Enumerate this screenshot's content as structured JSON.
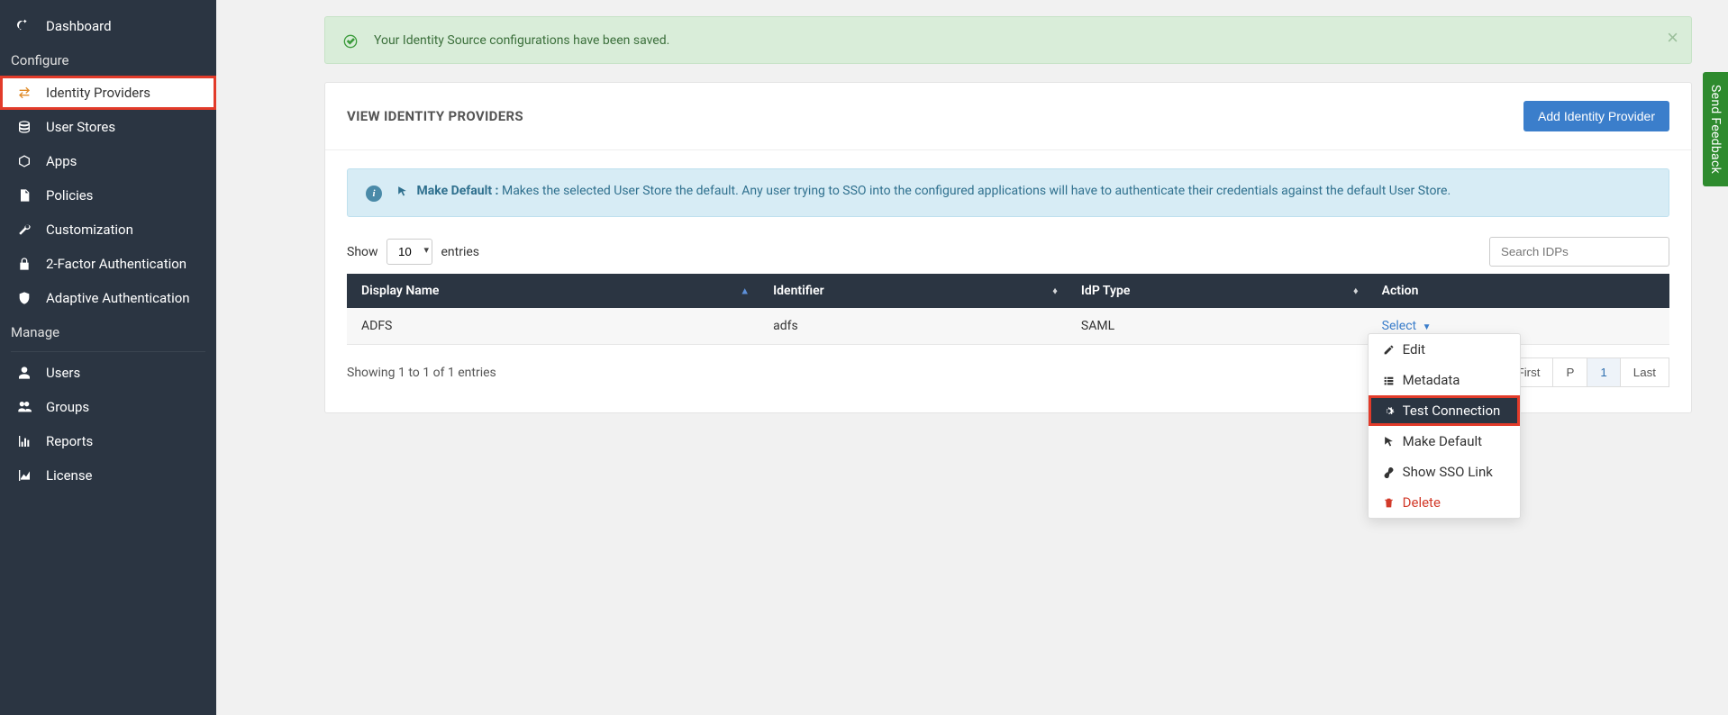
{
  "sidebar": {
    "dashboard": "Dashboard",
    "configure_heading": "Configure",
    "identity_providers": "Identity Providers",
    "user_stores": "User Stores",
    "apps": "Apps",
    "policies": "Policies",
    "customization": "Customization",
    "two_factor": "2-Factor Authentication",
    "adaptive_auth": "Adaptive Authentication",
    "manage_heading": "Manage",
    "users": "Users",
    "groups": "Groups",
    "reports": "Reports",
    "license": "License"
  },
  "alert": {
    "message": "Your Identity Source configurations have been saved."
  },
  "panel": {
    "title": "VIEW IDENTITY PROVIDERS",
    "add_button": "Add Identity Provider"
  },
  "info": {
    "title": "Make Default :",
    "body": " Makes the selected User Store the default. Any user trying to SSO into the configured applications will have to authenticate their credentials against the default User Store."
  },
  "table": {
    "show_label_pre": "Show",
    "show_label_post": "entries",
    "page_size": "10",
    "search_placeholder": "Search IDPs",
    "columns": {
      "display_name": "Display Name",
      "identifier": "Identifier",
      "idp_type": "IdP Type",
      "action": "Action"
    },
    "row": {
      "display_name": "ADFS",
      "identifier": "adfs",
      "idp_type": "SAML",
      "action_label": "Select"
    },
    "footer_info": "Showing 1 to 1 of 1 entries",
    "pager": {
      "first": "First",
      "prev": "P",
      "page": "1",
      "last": "Last"
    }
  },
  "dropdown": {
    "edit": "Edit",
    "metadata": "Metadata",
    "test_connection": "Test Connection",
    "make_default": "Make Default",
    "show_sso": "Show SSO Link",
    "delete": "Delete"
  },
  "feedback": "Send Feedback"
}
